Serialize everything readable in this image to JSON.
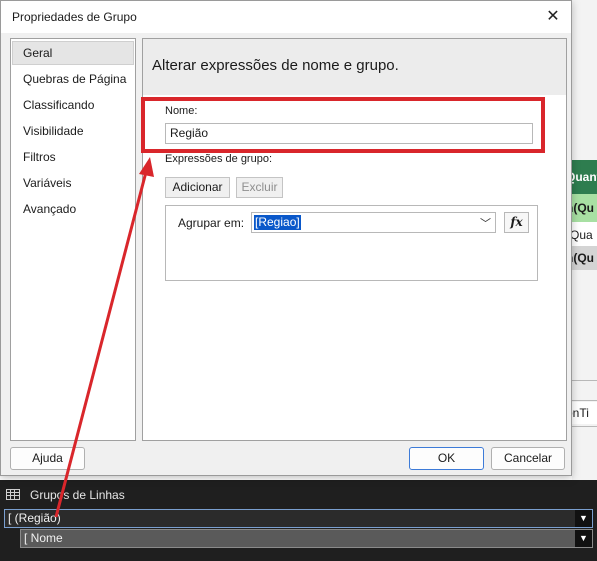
{
  "dialog": {
    "title": "Propriedades de Grupo",
    "close_symbol": "✕",
    "nav": [
      {
        "label": "Geral",
        "selected": true
      },
      {
        "label": "Quebras de Página"
      },
      {
        "label": "Classificando"
      },
      {
        "label": "Visibilidade"
      },
      {
        "label": "Filtros"
      },
      {
        "label": "Variáveis"
      },
      {
        "label": "Avançado"
      }
    ],
    "content": {
      "heading": "Alterar expressões de nome e grupo.",
      "name_label": "Nome:",
      "name_value": "Região",
      "group_expr_label": "Expressões de grupo:",
      "add_label": "Adicionar",
      "delete_label": "Excluir",
      "group_by_label": "Agrupar em:",
      "group_by_value": "[Regiao]",
      "fx_label": "fx"
    },
    "footer": {
      "help_label": "Ajuda",
      "ok_label": "OK",
      "cancel_label": "Cancelar"
    }
  },
  "background": {
    "header_text": "Quantid",
    "row1_text": "n(Qu",
    "row2_text": "(Qua",
    "row3_text": "n(Qu",
    "row4_text": "onTi"
  },
  "row_groups": {
    "title": "Grupos de Linhas",
    "items": [
      {
        "label": "[ (Região)"
      },
      {
        "label": "[ Nome"
      }
    ]
  },
  "colors": {
    "annotation_red": "#d9262b",
    "selection_blue": "#0a58ca",
    "header_green": "#2e7d4f"
  }
}
